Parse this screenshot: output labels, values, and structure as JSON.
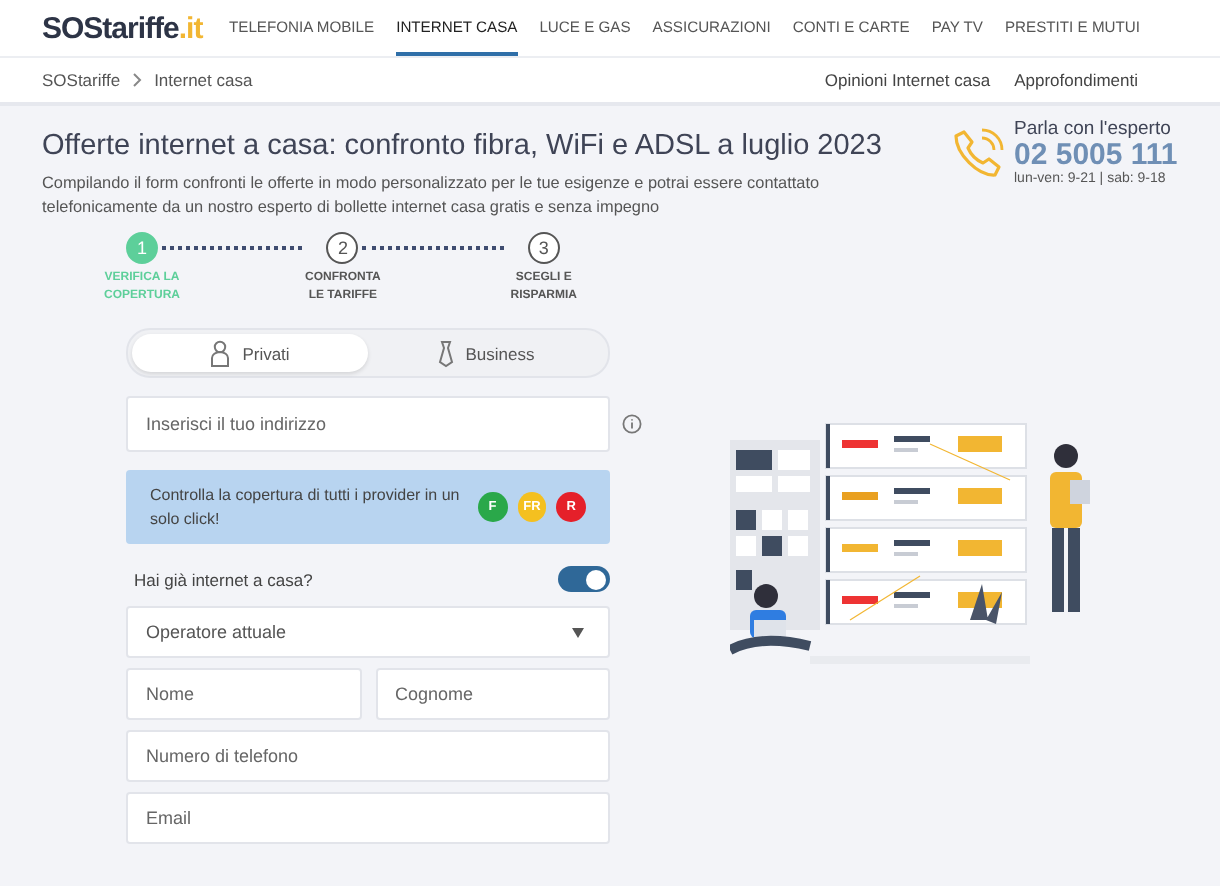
{
  "logo": {
    "main": "SOStariffe",
    "suffix": ".it"
  },
  "nav": [
    {
      "label": "TELEFONIA MOBILE",
      "selected": false
    },
    {
      "label": "INTERNET CASA",
      "selected": true
    },
    {
      "label": "LUCE E GAS",
      "selected": false
    },
    {
      "label": "ASSICURAZIONI",
      "selected": false
    },
    {
      "label": "CONTI E CARTE",
      "selected": false
    },
    {
      "label": "PAY TV",
      "selected": false
    },
    {
      "label": "PRESTITI E MUTUI",
      "selected": false
    }
  ],
  "breadcrumb": [
    "SOStariffe",
    "Internet casa"
  ],
  "subnav": [
    "Opinioni Internet casa",
    "Approfondimenti"
  ],
  "title": "Offerte internet a casa: confronto fibra, WiFi e ADSL a luglio 2023",
  "description": "Compilando il form confronti le offerte in modo personalizzato per le tue esigenze e potrai essere contattato telefonicamente da un nostro esperto di bollette internet casa gratis e senza impegno",
  "contact": {
    "label": "Parla con l'esperto",
    "phone": "02 5005 111",
    "hours": "lun-ven: 9-21 | sab: 9-18"
  },
  "steps": [
    {
      "number": "1",
      "label": "VERIFICA LA COPERTURA",
      "selected": true
    },
    {
      "number": "2",
      "label": "CONFRONTA LE TARIFFE",
      "selected": false
    },
    {
      "number": "3",
      "label": "SCEGLI E RISPARMIA",
      "selected": false
    }
  ],
  "customer_tabs": [
    {
      "label": "Privati",
      "kind": "person",
      "selected": true
    },
    {
      "label": "Business",
      "kind": "tie",
      "selected": false
    }
  ],
  "address": {
    "placeholder": "Inserisci il tuo indirizzo"
  },
  "info": {
    "text": "Controlla la copertura di tutti i provider in un solo click!",
    "badges": [
      {
        "label": "F",
        "color": "#2aa84a"
      },
      {
        "label": "FR",
        "color": "#f4c020"
      },
      {
        "label": "R",
        "color": "#e5202a"
      }
    ]
  },
  "has_internet": {
    "label": "Hai già internet a casa?",
    "on": true
  },
  "operator": {
    "placeholder": "Operatore attuale"
  },
  "name_fields": [
    {
      "placeholder": "Nome"
    },
    {
      "placeholder": "Cognome"
    }
  ],
  "phone_field": {
    "placeholder": "Numero di telefono"
  },
  "email_field": {
    "placeholder": "Email"
  }
}
